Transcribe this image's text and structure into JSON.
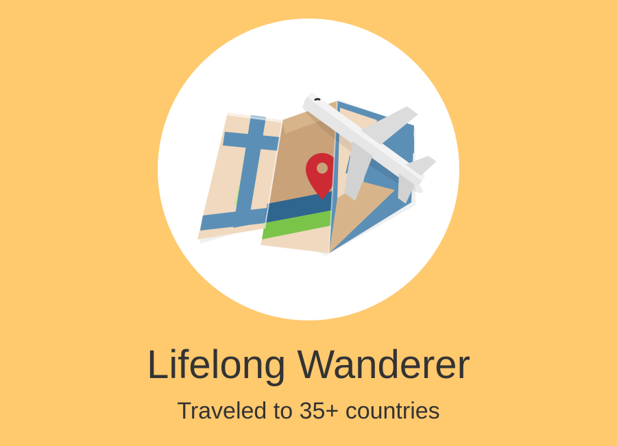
{
  "badge": {
    "icon": "map-with-airplane-icon",
    "title": "Lifelong Wanderer",
    "subtitle": "Traveled to 35+ countries"
  },
  "colors": {
    "background": "#FFC96E",
    "circle": "#FFFFFF",
    "text": "#333333",
    "map_tan": "#C9A27A",
    "map_beige": "#F0D9BE",
    "map_road": "#5B8FB6",
    "map_road_dark": "#2F6690",
    "map_green_light": "#BDEB8C",
    "map_green": "#7BC44A",
    "pin": "#CC2B33",
    "plane": "#E6E6E6"
  }
}
